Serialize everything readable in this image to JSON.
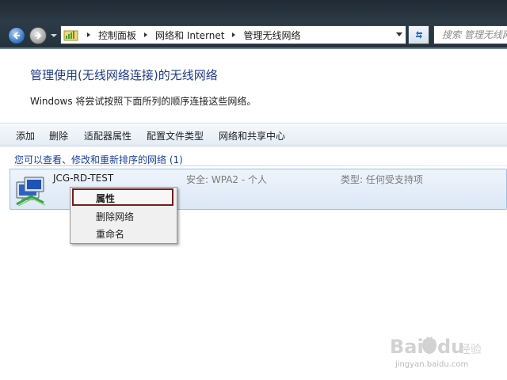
{
  "address_bar": {
    "crumbs": [
      "控制面板",
      "网络和 Internet",
      "管理无线网络"
    ],
    "search_placeholder": "搜索 管理无线网络"
  },
  "page": {
    "title": "管理使用(无线网络连接)的无线网络",
    "description": "Windows 将尝试按照下面所列的顺序连接这些网络。"
  },
  "toolbar": {
    "add_label": "添加",
    "delete_label": "删除",
    "adapter_properties_label": "适配器属性",
    "profile_type_label": "配置文件类型",
    "network_sharing_center_label": "网络和共享中心"
  },
  "list": {
    "group_header": "您可以查看、修改和重新排序的网络 (1)",
    "networks": [
      {
        "name": "JCG-RD-TEST",
        "security": "安全: WPA2 - 个人",
        "type": "类型: 任何受支持项"
      }
    ]
  },
  "context_menu": {
    "items": [
      "属性",
      "删除网络",
      "重命名"
    ],
    "highlighted": "属性"
  },
  "watermark": {
    "logo_text": "Baidu经验",
    "sub_text": "jingyan.baidu.com"
  },
  "colors": {
    "title_blue": "#1f3a8a",
    "group_header_blue": "#1c3fa0",
    "selection_fill": "#dce8f6",
    "highlight_border": "#7a1c1c"
  },
  "icons": [
    "back-arrow-icon",
    "forward-arrow-icon",
    "history-dropdown-icon",
    "network-folder-icon",
    "breadcrumb-arrow-icon",
    "refresh-icon",
    "wireless-network-icon"
  ]
}
